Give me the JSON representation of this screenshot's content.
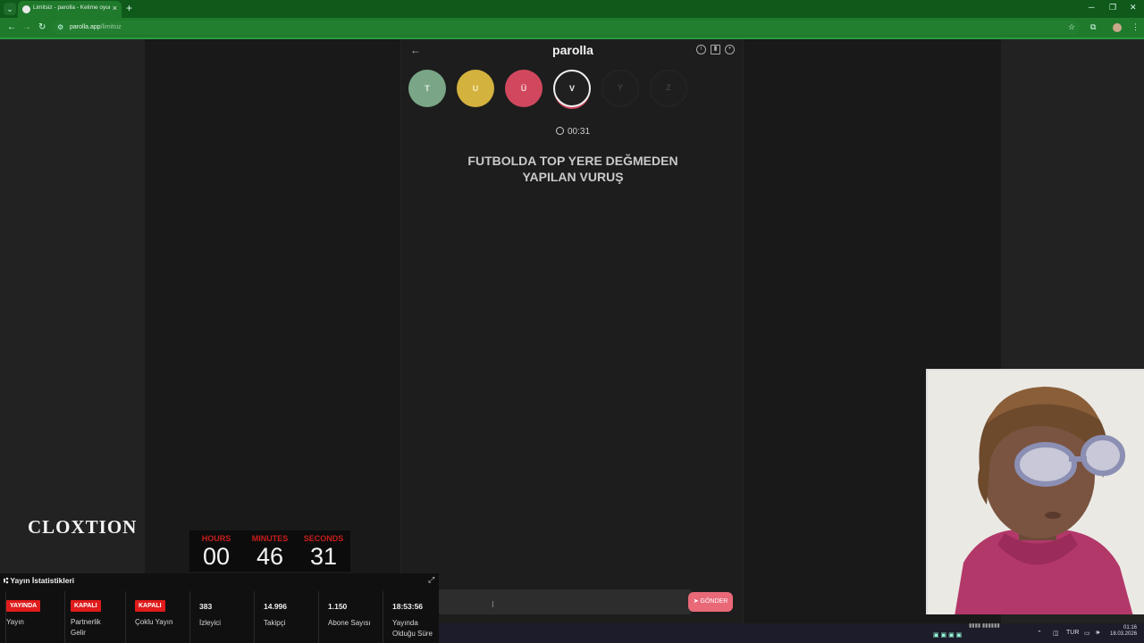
{
  "browser": {
    "tab_title": "Limitsiz - parolla - Kelime oyunu",
    "url_host": "parolla.app",
    "url_path": "/limitsiz"
  },
  "game": {
    "logo": "parolla",
    "letters": [
      {
        "letter": "T",
        "state": "correct"
      },
      {
        "letter": "U",
        "state": "passed"
      },
      {
        "letter": "Ü",
        "state": "wrong"
      },
      {
        "letter": "V",
        "state": "active"
      },
      {
        "letter": "Y",
        "state": "pending"
      },
      {
        "letter": "Z",
        "state": "pending"
      }
    ],
    "timer": "00:31",
    "question_line1": "FUTBOLDA TOP YERE DEĞMEDEN",
    "question_line2": "YAPILAN VURUŞ",
    "answer_value": "",
    "send_label": "GÖNDER"
  },
  "overlay": {
    "brand": "CLOXTION",
    "countdown": {
      "hours_label": "HOURS",
      "hours": "00",
      "minutes_label": "MINUTES",
      "minutes": "46",
      "seconds_label": "SECONDS",
      "seconds": "31"
    },
    "stats_title": "Yayın İstatistikleri",
    "stats": {
      "yayin_badge": "YAYINDA",
      "yayin_label": "Yayın",
      "partner_badge": "KAPALI",
      "partner_label": "Partnerlik Gelir",
      "coklu_badge": "KAPALI",
      "coklu_label": "Çoklu Yayın",
      "izleyici_value": "383",
      "izleyici_label": "İzleyici",
      "takipci_value": "14.996",
      "takipci_label": "Takipçi",
      "abone_value": "1.150",
      "abone_label": "Abone Sayısı",
      "sure_value": "18:53:56",
      "sure_label": "Yayında Olduğu Süre"
    }
  },
  "taskbar": {
    "language": "TUR",
    "time": "01:16",
    "date": "18.03.2026"
  },
  "colors": {
    "browser_green": "#1f7a2c",
    "correct": "#7aa687",
    "passed": "#d4b23e",
    "wrong": "#d1485e",
    "send": "#e96979",
    "badge_red": "#e01b1b",
    "countdown_label": "#c81d1d"
  }
}
